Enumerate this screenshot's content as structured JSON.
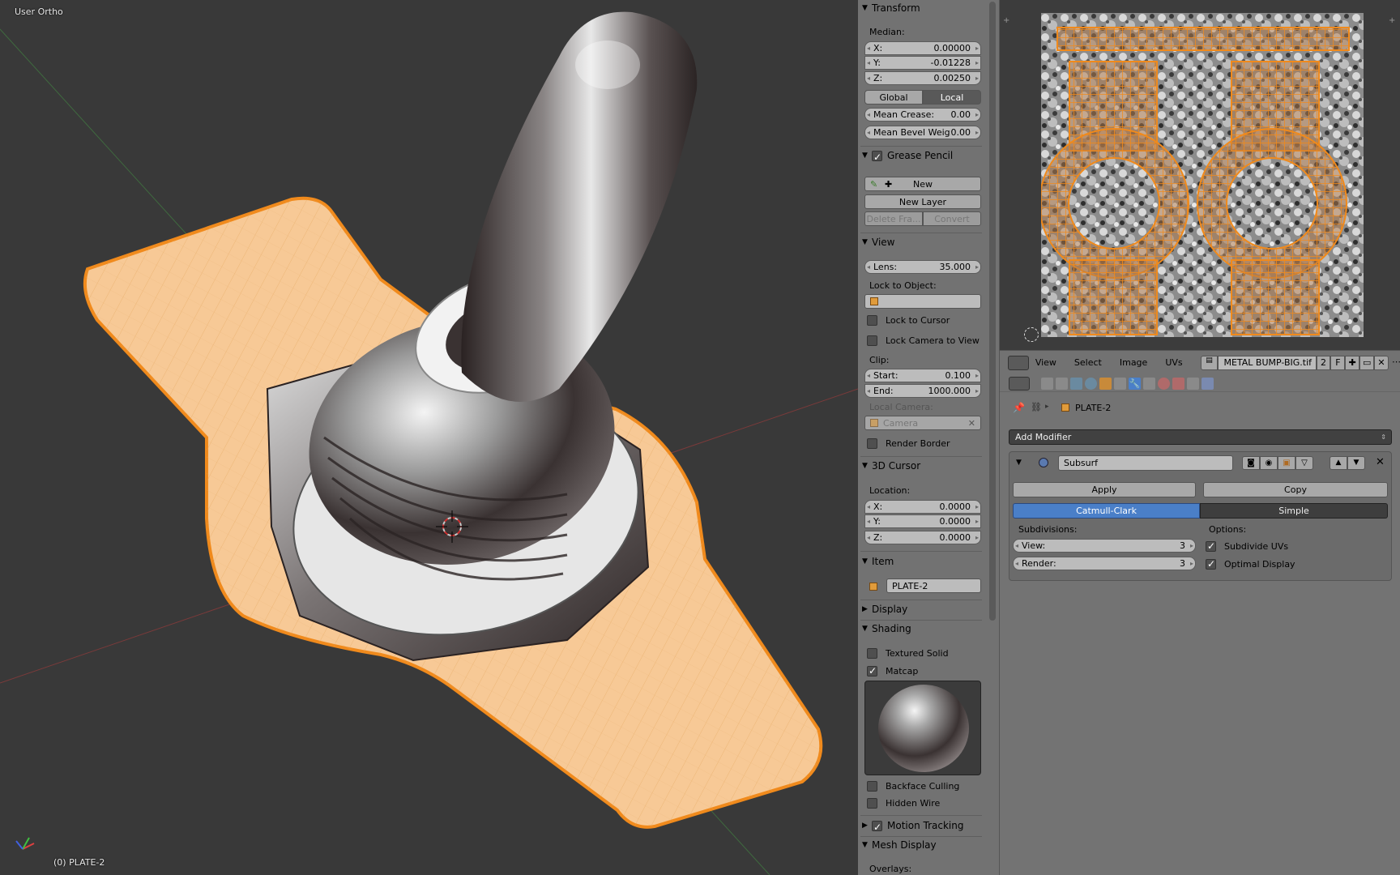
{
  "viewport": {
    "view_name": "User Ortho",
    "object_status": "(0) PLATE-2"
  },
  "npanel": {
    "transform": {
      "title": "Transform",
      "median_label": "Median:",
      "x_label": "X:",
      "x_value": "0.00000",
      "y_label": "Y:",
      "y_value": "-0.01228",
      "z_label": "Z:",
      "z_value": "0.00250",
      "global": "Global",
      "local": "Local",
      "crease_label": "Mean Crease:",
      "crease_value": "0.00",
      "bevel_label": "Mean Bevel Weig:",
      "bevel_value": "0.00"
    },
    "grease_pencil": {
      "title": "Grease Pencil",
      "new": "New",
      "new_layer": "New Layer",
      "delete_frame": "Delete Fra...",
      "convert": "Convert"
    },
    "view": {
      "title": "View",
      "lens_label": "Lens:",
      "lens_value": "35.000",
      "lock_to_object": "Lock to Object:",
      "lock_to_cursor": "Lock to Cursor",
      "lock_camera": "Lock Camera to View",
      "clip_label": "Clip:",
      "start_label": "Start:",
      "start_value": "0.100",
      "end_label": "End:",
      "end_value": "1000.000",
      "local_camera": "Local Camera:",
      "camera": "Camera",
      "render_border": "Render Border"
    },
    "cursor": {
      "title": "3D Cursor",
      "location": "Location:",
      "x_label": "X:",
      "x_value": "0.0000",
      "y_label": "Y:",
      "y_value": "0.0000",
      "z_label": "Z:",
      "z_value": "0.0000"
    },
    "item": {
      "title": "Item",
      "name": "PLATE-2"
    },
    "display": {
      "title": "Display"
    },
    "shading": {
      "title": "Shading",
      "textured_solid": "Textured Solid",
      "matcap": "Matcap",
      "backface": "Backface Culling",
      "hidden_wire": "Hidden Wire"
    },
    "motion_tracking": {
      "title": "Motion Tracking"
    },
    "mesh_display": {
      "title": "Mesh Display",
      "overlays": "Overlays:"
    }
  },
  "uv_header": {
    "menus": [
      "View",
      "Select",
      "Image",
      "UVs"
    ],
    "image_name": "METAL BUMP-BIG.tif",
    "users": "2",
    "fake": "F"
  },
  "properties": {
    "context_object": "PLATE-2",
    "add_modifier": "Add Modifier",
    "modifier_name": "Subsurf",
    "apply": "Apply",
    "copy": "Copy",
    "catmull": "Catmull-Clark",
    "simple": "Simple",
    "subdivisions_label": "Subdivisions:",
    "view_label": "View:",
    "view_value": "3",
    "render_label": "Render:",
    "render_value": "3",
    "options_label": "Options:",
    "subdivide_uvs": "Subdivide UVs",
    "optimal_display": "Optimal Display"
  },
  "colors": {
    "selected_orange": "#f08a1c",
    "active_blue": "#4a7fc8",
    "panel_gray": "#727272"
  }
}
